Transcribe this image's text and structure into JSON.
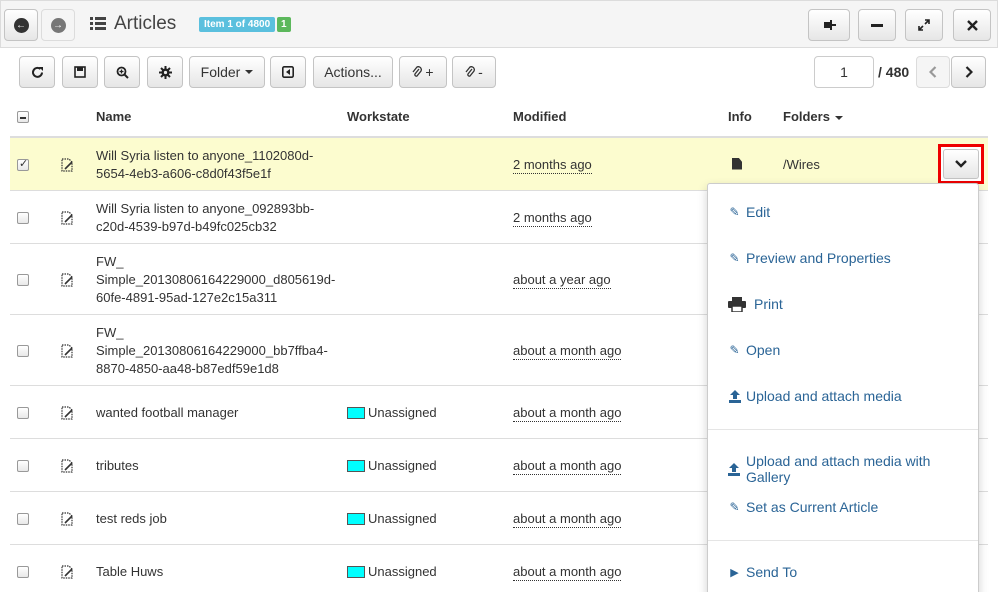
{
  "header": {
    "title": "Articles",
    "item_badge": "Item 1 of 4800",
    "count_badge": "1"
  },
  "toolbar": {
    "folder_label": "Folder",
    "actions_label": "Actions...",
    "attach_add_label": "+",
    "attach_remove_label": "-",
    "page_current": "1",
    "page_total": "/ 480"
  },
  "table": {
    "columns": {
      "name": "Name",
      "workstate": "Workstate",
      "modified": "Modified",
      "info": "Info",
      "folders": "Folders"
    },
    "rows": [
      {
        "name": "Will Syria listen to anyone_1102080d-5654-4eb3-a606-c8d0f43f5e1f",
        "workstate": "",
        "modified": "2 months ago",
        "folder": "/Wires",
        "checked": true
      },
      {
        "name": "Will Syria listen to anyone_092893bb-c20d-4539-b97d-b49fc025cb32",
        "workstate": "",
        "modified": "2 months ago",
        "folder": "",
        "checked": false
      },
      {
        "name": "FW_ Simple_20130806164229000_d805619d-60fe-4891-95ad-127e2c15a311",
        "workstate": "",
        "modified": "about a year ago",
        "folder": "",
        "checked": false
      },
      {
        "name": "FW_ Simple_20130806164229000_bb7ffba4-8870-4850-aa48-b87edf59e1d8",
        "workstate": "",
        "modified": "about a month ago",
        "folder": "",
        "checked": false
      },
      {
        "name": "wanted football manager",
        "workstate": "Unassigned",
        "modified": "about a month ago",
        "folder": "",
        "checked": false
      },
      {
        "name": "tributes",
        "workstate": "Unassigned",
        "modified": "about a month ago",
        "folder": "",
        "checked": false
      },
      {
        "name": "test reds job",
        "workstate": "Unassigned",
        "modified": "about a month ago",
        "folder": "",
        "checked": false
      },
      {
        "name": "Table Huws",
        "workstate": "Unassigned",
        "modified": "about a month ago",
        "folder": "",
        "checked": false
      }
    ]
  },
  "menu": {
    "items": [
      {
        "label": "Edit",
        "icon": "edit-icon"
      },
      {
        "label": "Preview and Properties",
        "icon": "edit-icon"
      },
      {
        "label": "Print",
        "icon": "print-icon"
      },
      {
        "label": "Open",
        "icon": "edit-icon"
      },
      {
        "label": "Upload and attach media",
        "icon": "upload-icon"
      },
      {
        "label": "Upload and attach media with Gallery",
        "icon": "upload-icon"
      },
      {
        "label": "Set as Current Article",
        "icon": "edit-icon"
      },
      {
        "label": "Send To",
        "icon": "play-icon"
      }
    ]
  },
  "colors": {
    "selected_row": "#fcfccf",
    "link": "#2a6496",
    "badge_info": "#5bc0de",
    "badge_success": "#5cb85c",
    "workstate_unassigned": "#00ffff",
    "highlight_border": "#ee0000"
  }
}
